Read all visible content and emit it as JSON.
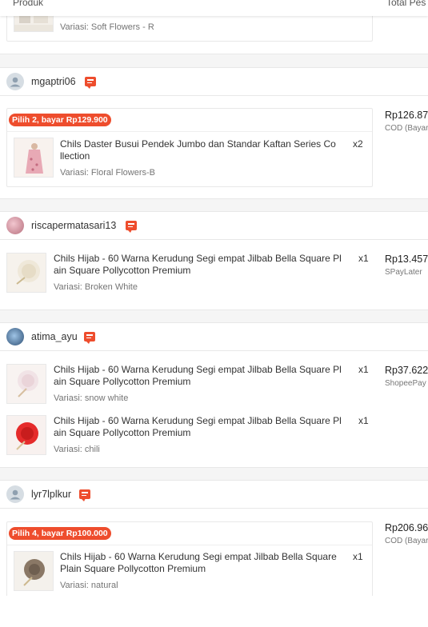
{
  "header": {
    "product_label": "Produk",
    "total_label": "Total Pes"
  },
  "orders": [
    {
      "variant": "Variasi: Soft Flowers - R"
    },
    {
      "username": "mgaptri06",
      "bundle": "Pilih 2, bayar Rp129.900",
      "price": "Rp126.87",
      "payment": "COD (Bayar",
      "items": [
        {
          "name_l1": "Chils Daster Busui Pendek Jumbo dan Standar Kaftan Series Co",
          "name_l2": "llection",
          "qty": "x2",
          "variant": "Variasi: Floral Flowers-B"
        }
      ]
    },
    {
      "username": "riscapermatasari13",
      "price": "Rp13.457",
      "payment": "SPayLater",
      "items": [
        {
          "name_l1": "Chils Hijab - 60 Warna Kerudung Segi empat Jilbab Bella Square Pl",
          "name_l2": "ain Square Pollycotton Premium",
          "qty": "x1",
          "variant": "Variasi: Broken White"
        }
      ]
    },
    {
      "username": "atima_ayu",
      "price": "Rp37.622",
      "payment": "ShopeePay",
      "items": [
        {
          "name_l1": "Chils Hijab - 60 Warna Kerudung Segi empat Jilbab Bella Square Pl",
          "name_l2": "ain Square Pollycotton Premium",
          "qty": "x1",
          "variant": "Variasi: snow white"
        },
        {
          "name_l1": "Chils Hijab - 60 Warna Kerudung Segi empat Jilbab Bella Square Pl",
          "name_l2": "ain Square Pollycotton Premium",
          "qty": "x1",
          "variant": "Variasi: chili"
        }
      ]
    },
    {
      "username": "lyr7lplkur",
      "bundle": "Pilih 4, bayar Rp100.000",
      "price": "Rp206.96",
      "payment": "COD (Bayar",
      "items": [
        {
          "name_l1": "Chils Hijab - 60 Warna Kerudung Segi empat Jilbab Bella Square",
          "name_l2": "Plain Square Pollycotton Premium",
          "qty": "x1",
          "variant": "Variasi: natural"
        }
      ]
    }
  ]
}
